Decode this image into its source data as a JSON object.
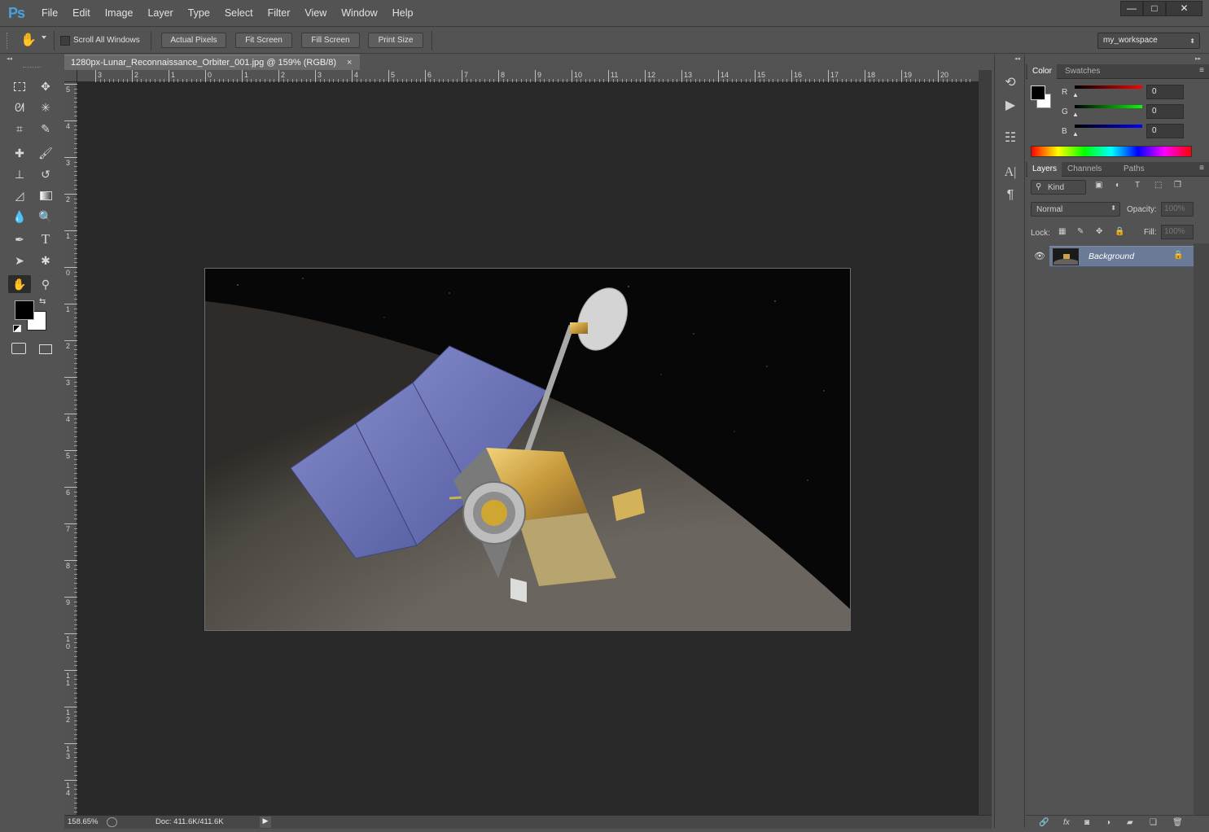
{
  "app": {
    "logo": "Ps"
  },
  "menu": [
    "File",
    "Edit",
    "Image",
    "Layer",
    "Type",
    "Select",
    "Filter",
    "View",
    "Window",
    "Help"
  ],
  "window_controls": {
    "minimize": "—",
    "maximize": "□",
    "close": "✕"
  },
  "options_bar": {
    "scroll_all_windows": "Scroll All Windows",
    "actual_pixels": "Actual Pixels",
    "fit_screen": "Fit Screen",
    "fill_screen": "Fill Screen",
    "print_size": "Print Size",
    "workspace": "my_workspace"
  },
  "document": {
    "tab_title": "1280px-Lunar_Reconnaissance_Orbiter_001.jpg @ 159% (RGB/8)",
    "close": "×",
    "ruler_top": [
      "3",
      "2",
      "1",
      "0",
      "1",
      "2",
      "3",
      "4",
      "5",
      "6",
      "7",
      "8",
      "9",
      "10",
      "11",
      "12",
      "13",
      "14",
      "15",
      "16",
      "17",
      "18",
      "19",
      "20"
    ],
    "ruler_left": [
      "5",
      "4",
      "3",
      "2",
      "1",
      "0",
      "1",
      "2",
      "3",
      "4",
      "5",
      "6",
      "7",
      "8",
      "9",
      "10",
      "11",
      "12",
      "13",
      "14"
    ]
  },
  "status": {
    "zoom": "158.65%",
    "doc": "Doc: 411.6K/411.6K"
  },
  "color_panel": {
    "tabs": [
      "Color",
      "Swatches"
    ],
    "r_label": "R",
    "g_label": "G",
    "b_label": "B",
    "r": "0",
    "g": "0",
    "b": "0",
    "foreground": "#000000",
    "background": "#ffffff"
  },
  "layers_panel": {
    "tabs": [
      "Layers",
      "Channels",
      "Paths"
    ],
    "kind": "Kind",
    "blend_mode": "Normal",
    "opacity_label": "Opacity:",
    "opacity": "100%",
    "lock_label": "Lock:",
    "fill_label": "Fill:",
    "fill": "100%",
    "layers": [
      {
        "name": "Background"
      }
    ]
  }
}
